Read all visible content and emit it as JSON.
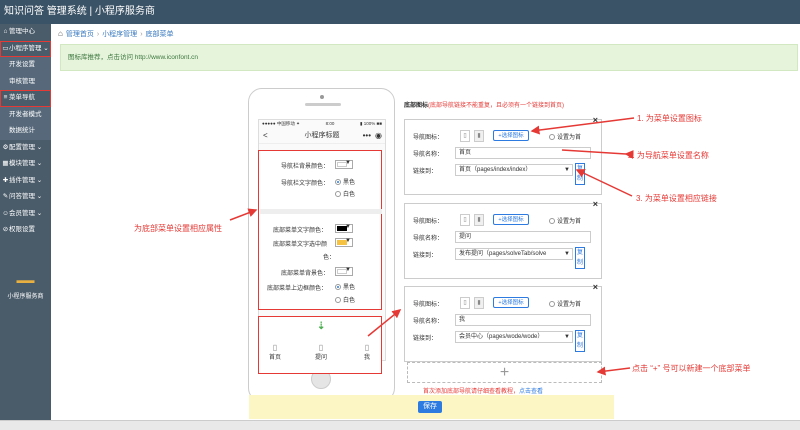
{
  "topbar": {
    "title": "知识问答 管理系统 | 小程序服务商"
  },
  "sidebar": {
    "items": [
      {
        "label": "管理中心",
        "icon": "home-icon",
        "glyph": "⌂"
      },
      {
        "label": "小程序管理 ⌄",
        "icon": "monitor-icon",
        "glyph": "▭"
      },
      {
        "label": "开发设置",
        "sub": true
      },
      {
        "label": "审核管理",
        "sub": true
      },
      {
        "label": "菜单导航",
        "icon": "menu-icon",
        "glyph": "≡"
      },
      {
        "label": "开发者模式",
        "sub": true
      },
      {
        "label": "数据统计",
        "sub": true
      },
      {
        "label": "配置管理 ⌄",
        "icon": "gear-icon",
        "glyph": "⚙"
      },
      {
        "label": "模块管理 ⌄",
        "icon": "grid-icon",
        "glyph": "▦"
      },
      {
        "label": "插件管理 ⌄",
        "icon": "plugin-icon",
        "glyph": "✚"
      },
      {
        "label": "问答管理 ⌄",
        "icon": "qa-icon",
        "glyph": "✎"
      },
      {
        "label": "会员管理 ⌄",
        "icon": "user-icon",
        "glyph": "☺"
      },
      {
        "label": "权限设置",
        "icon": "lock-icon",
        "glyph": "⊘"
      }
    ],
    "logo": "▬▬",
    "brand": "小程序服务商"
  },
  "breadcrumb": {
    "items": [
      "管理首页",
      "小程序管理",
      "底部菜单"
    ]
  },
  "notice": {
    "text": "图标库推荐，点击访问 http://www.iconfont.cn"
  },
  "phone": {
    "status_left": "●●●●● 中国移动 ✦",
    "status_time": "8:00",
    "status_right": "▮ 100% ■■",
    "title": "小程序标题",
    "back": "<",
    "dots": "•••",
    "target": "◉"
  },
  "attrs": {
    "nav_bg_label": "导航栏背景颜色：",
    "nav_text_label": "导航栏文字颜色：",
    "nav_text_black": "黑色",
    "nav_text_white": "白色",
    "menu_text_label": "底部菜单文字颜色：",
    "menu_text_active_label1": "底部菜单文字选中颜",
    "menu_text_active_label2": "色：",
    "menu_bg_label": "底部菜单背景色：",
    "menu_border_label": "底部菜单上边框颜色：",
    "menu_border_black": "黑色",
    "menu_border_white": "白色"
  },
  "tabbar": {
    "items": [
      "首页",
      "提问",
      "我"
    ]
  },
  "config": {
    "header": "底部图标",
    "header_note": "(底部导航链接不能重复，且必须有一个链接到首页)",
    "icon_label": "导航图标：",
    "name_label": "导航名称：",
    "link_label": "链接到：",
    "select_icon": "+选择图标",
    "set_home": "设置为首",
    "copy": "复制",
    "cards": [
      {
        "name": "首页",
        "link": "首页（pages/index/index）"
      },
      {
        "name": "提问",
        "link": "发布提问（pages/solveTab/solve"
      },
      {
        "name": "我",
        "link": "会员中心（pages/wode/wode）"
      }
    ],
    "add": "+",
    "tip": "首次添加底部导航请仔细查看教程，",
    "tip_link": "点击查看",
    "save": "保存"
  },
  "annotations": {
    "a1": "1. 为菜单设置图标",
    "a2": "2. 为导航菜单设置名称",
    "a3": "3. 为菜单设置相应链接",
    "a4": "为底部菜单设置相应属性",
    "a5": "点击 “+” 号可以新建一个底部菜单"
  },
  "colors": {
    "accent": "#2d7be0",
    "annotation": "#e53935",
    "sidebar": "#4a5b6a",
    "topbar": "#3b5366"
  }
}
